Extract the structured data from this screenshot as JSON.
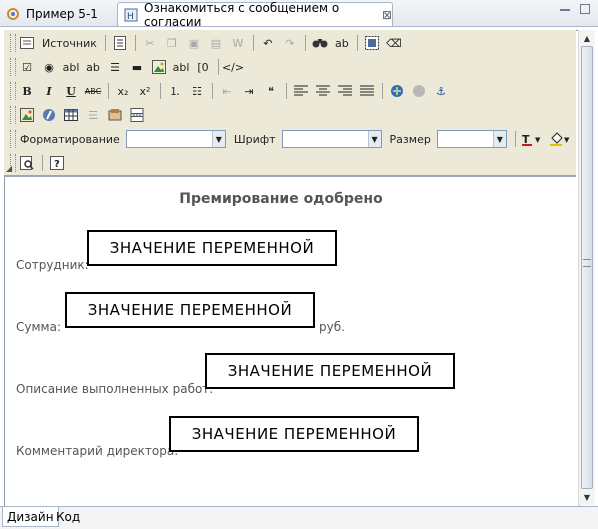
{
  "tabs": [
    {
      "label": "Пример 5-1",
      "icon": "form-icon"
    },
    {
      "label": "Ознакомиться с сообщением о согласии",
      "icon": "html-doc-icon",
      "close": "⊠"
    }
  ],
  "toolbar": {
    "source_label": "Источник",
    "format_label": "Форматирование",
    "font_label": "Шрифт",
    "size_label": "Размер",
    "format_value": "",
    "font_value": "",
    "size_value": "",
    "bold": "B",
    "italic": "I",
    "underline": "U",
    "strike": "ABC",
    "subscript": "x₂",
    "superscript": "x²"
  },
  "document": {
    "title": "Премирование одобрено",
    "fields": [
      {
        "label": "Сотрудник:",
        "value": "ЗНАЧЕНИЕ ПЕРЕМЕННОЙ",
        "suffix": ""
      },
      {
        "label": "Сумма:",
        "value": "ЗНАЧЕНИЕ ПЕРЕМЕННОЙ",
        "suffix": "руб."
      },
      {
        "label": "Описание выполненных работ:",
        "value": "ЗНАЧЕНИЕ ПЕРЕМЕННОЙ",
        "suffix": ""
      },
      {
        "label": "Комментарий директора:",
        "value": "ЗНАЧЕНИЕ ПЕРЕМЕННОЙ",
        "suffix": ""
      }
    ]
  },
  "bottom_tabs": [
    {
      "label": "Дизайн",
      "active": true
    },
    {
      "label": "Код",
      "active": false
    }
  ]
}
